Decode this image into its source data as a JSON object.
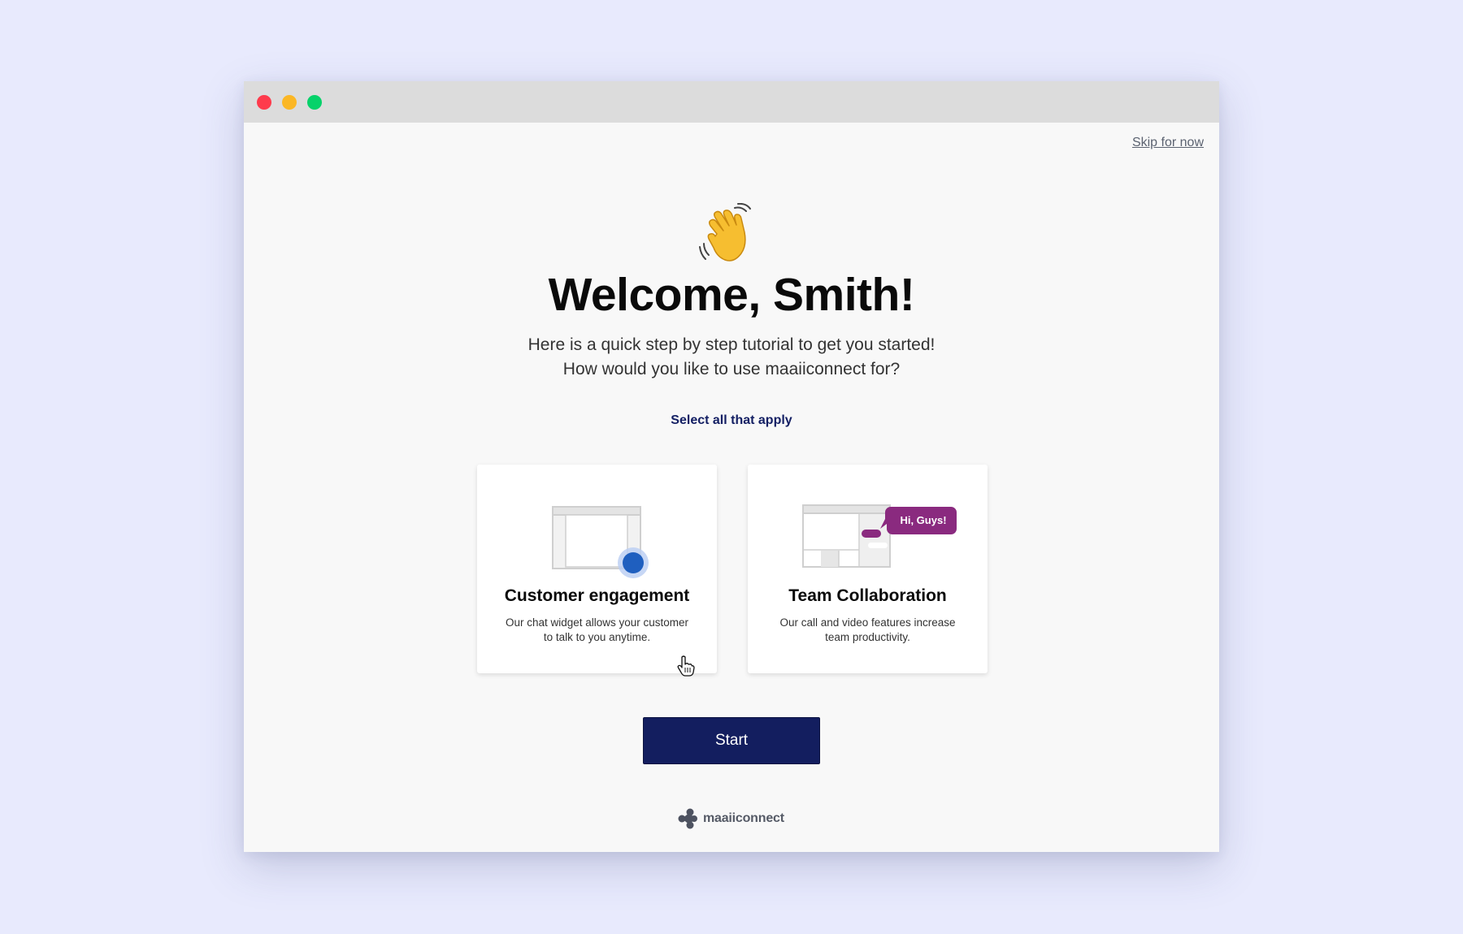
{
  "window": {
    "controls": [
      "close",
      "minimize",
      "maximize"
    ]
  },
  "header": {
    "skip_label": "Skip for now"
  },
  "hero": {
    "icon": "waving-hand-icon",
    "title": "Welcome, Smith!",
    "subtitle_line1": "Here is a quick step by step tutorial to get you started!",
    "subtitle_line2": "How would you like to use maaiiconnect for?"
  },
  "selection": {
    "hint": "Select all that apply",
    "options": [
      {
        "title": "Customer engagement",
        "desc_line1": "Our chat widget allows your customer",
        "desc_line2": "to talk to you anytime.",
        "icon": "chat-widget-illustration"
      },
      {
        "title": "Team Collaboration",
        "desc_line1": "Our call and video features increase",
        "desc_line2": "team productivity.",
        "icon": "team-chat-illustration",
        "bubble_text": "Hi, Guys!"
      }
    ]
  },
  "actions": {
    "start_label": "Start"
  },
  "footer": {
    "brand_name": "maaiiconnect"
  },
  "colors": {
    "background": "#e8eafd",
    "primary": "#131e5f",
    "accent_purple": "#8a2a7f",
    "widget_blue": "#1f5fbf"
  }
}
